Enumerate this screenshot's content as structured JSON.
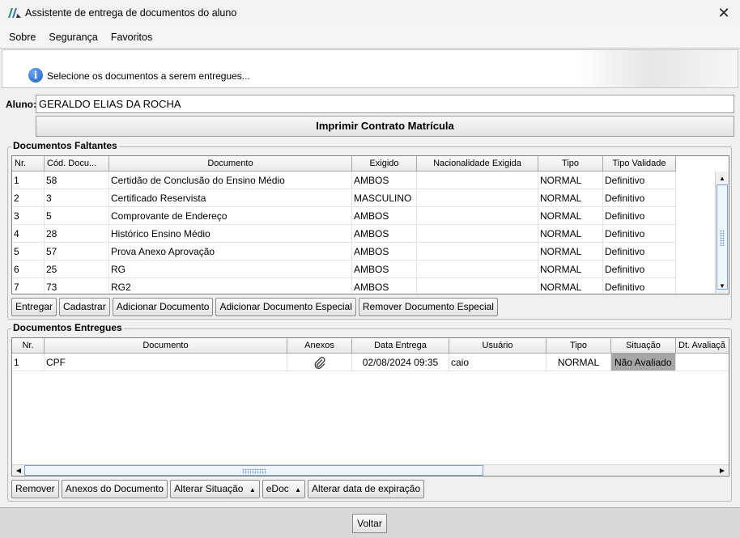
{
  "window": {
    "title": "Assistente de entrega de documentos do aluno",
    "close_glyph": "✕",
    "app_icon": "app-logo-icon"
  },
  "menu": {
    "items": [
      "Sobre",
      "Segurança",
      "Favoritos"
    ]
  },
  "banner": {
    "icon": "info-icon",
    "icon_glyph": "i",
    "text": "Selecione os documentos a serem entregues..."
  },
  "aluno": {
    "label": "Aluno:",
    "value": "GERALDO ELIAS DA ROCHA"
  },
  "contrato_button": "Imprimir Contrato Matrícula",
  "faltantes": {
    "title": "Documentos Faltantes",
    "columns": [
      "Nr.",
      "Cód. Docu...",
      "Documento",
      "Exigido",
      "Nacionalidade Exigida",
      "Tipo",
      "Tipo Validade"
    ],
    "rows": [
      [
        "1",
        "58",
        "Certidão de Conclusão do Ensino Médio",
        "AMBOS",
        "",
        "NORMAL",
        "Definitivo"
      ],
      [
        "2",
        "3",
        "Certificado Reservista",
        "MASCULINO",
        "",
        "NORMAL",
        "Definitivo"
      ],
      [
        "3",
        "5",
        "Comprovante de Endereço",
        "AMBOS",
        "",
        "NORMAL",
        "Definitivo"
      ],
      [
        "4",
        "28",
        "Histórico Ensino Médio",
        "AMBOS",
        "",
        "NORMAL",
        "Definitivo"
      ],
      [
        "5",
        "57",
        "Prova Anexo Aprovação",
        "AMBOS",
        "",
        "NORMAL",
        "Definitivo"
      ],
      [
        "6",
        "25",
        "RG",
        "AMBOS",
        "",
        "NORMAL",
        "Definitivo"
      ],
      [
        "7",
        "73",
        "RG2",
        "AMBOS",
        "",
        "NORMAL",
        "Definitivo"
      ]
    ],
    "buttons": [
      "Entregar",
      "Cadastrar",
      "Adicionar Documento",
      "Adicionar Documento Especial",
      "Remover Documento Especial"
    ]
  },
  "entregues": {
    "title": "Documentos Entregues",
    "columns": [
      "Nr.",
      "Documento",
      "Anexos",
      "Data Entrega",
      "Usuário",
      "Tipo",
      "Situação",
      "Dt. Avaliaçã"
    ],
    "rows": [
      {
        "nr": "1",
        "documento": "CPF",
        "anexos_icon": "paperclip-icon",
        "data": "02/08/2024 09:35",
        "usuario": "caio",
        "tipo": "NORMAL",
        "situacao": "Não Avaliado",
        "dt_avaliacao": ""
      }
    ],
    "buttons": [
      "Remover",
      "Anexos do Documento",
      "Alterar Situação",
      "eDoc",
      "Alterar data de expiração"
    ],
    "dropdown_glyph": "▲"
  },
  "footer": {
    "back_button": "Voltar"
  },
  "colors": {
    "status_bg": "#a6a6a6",
    "scroll_accent": "#7aa4d4"
  }
}
